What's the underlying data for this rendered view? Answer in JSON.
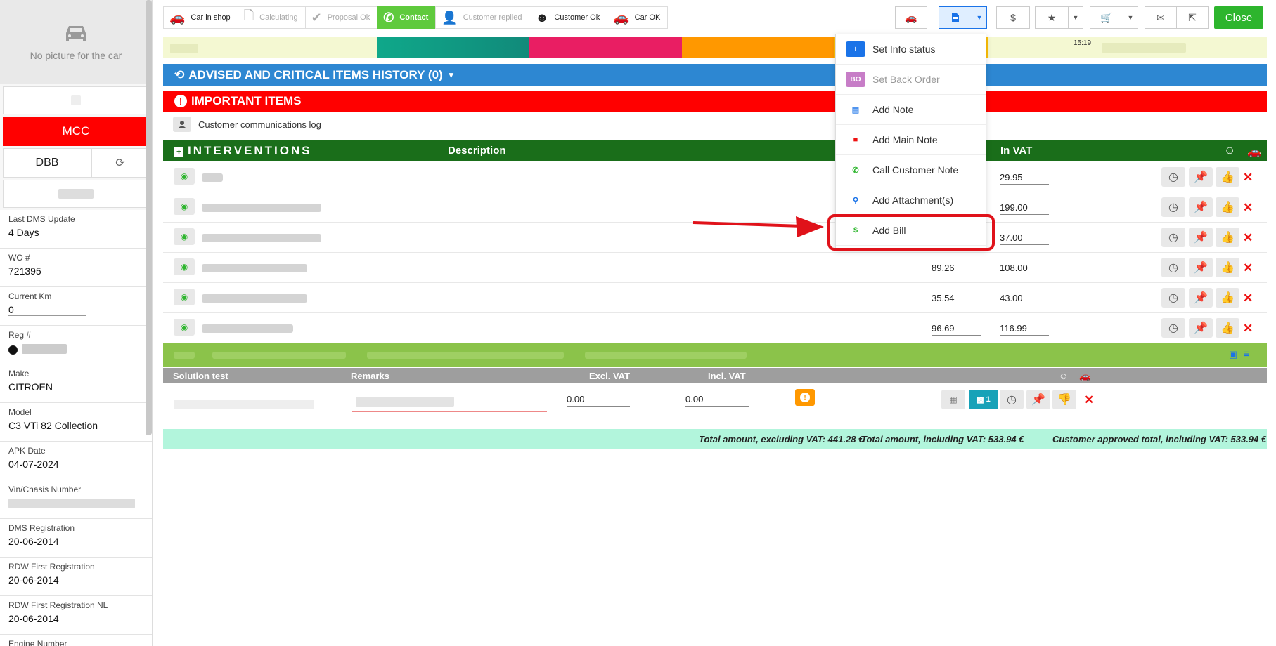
{
  "sidebar": {
    "no_picture": "No picture for the car",
    "mcc": "MCC",
    "dbb": "DBB",
    "fields": [
      {
        "label": "Last DMS Update",
        "value": "4 Days"
      },
      {
        "label": "WO #",
        "value": "721395"
      },
      {
        "label": "Current Km",
        "value": "0"
      },
      {
        "label": "Reg #",
        "value": ""
      },
      {
        "label": "Make",
        "value": "CITROEN"
      },
      {
        "label": "Model",
        "value": "C3 VTi 82 Collection"
      },
      {
        "label": "APK Date",
        "value": "04-07-2024"
      },
      {
        "label": "Vin/Chasis Number",
        "value": ""
      },
      {
        "label": "DMS Registration",
        "value": "20-06-2014"
      },
      {
        "label": "RDW First Registration",
        "value": "20-06-2014"
      },
      {
        "label": "RDW First Registration NL",
        "value": "20-06-2014"
      },
      {
        "label": "Engine Number",
        "value": ""
      }
    ]
  },
  "steps": [
    {
      "label": "Car in shop",
      "state": "done"
    },
    {
      "label": "Calculating",
      "state": "dim"
    },
    {
      "label": "Proposal Ok",
      "state": "dim"
    },
    {
      "label": "Contact",
      "state": "active"
    },
    {
      "label": "Customer replied",
      "state": "dim"
    },
    {
      "label": "Customer Ok",
      "state": "done"
    },
    {
      "label": "Car OK",
      "state": "done"
    }
  ],
  "toolbar": {
    "close": "Close",
    "dollar": "$"
  },
  "colorbar": {
    "time": "15:19"
  },
  "sections": {
    "advised": "ADVISED AND CRITICAL ITEMS HISTORY (0)",
    "important": "IMPORTANT ITEMS",
    "comm_log": "Customer communications log",
    "interventions": "INTERVENTIONS",
    "description": "Description",
    "in_vat": "In VAT"
  },
  "interventions": [
    {
      "excl": "",
      "incl": "29.95"
    },
    {
      "excl": "",
      "incl": "199.00"
    },
    {
      "excl": "",
      "incl": "37.00"
    },
    {
      "excl": "89.26",
      "incl": "108.00"
    },
    {
      "excl": "35.54",
      "incl": "43.00"
    },
    {
      "excl": "96.69",
      "incl": "116.99"
    }
  ],
  "solution": {
    "headers": {
      "solution": "Solution test",
      "remarks": "Remarks",
      "excl": "Excl. VAT",
      "incl": "Incl. VAT"
    },
    "excl_value": "0.00",
    "incl_value": "0.00",
    "image_count": "1"
  },
  "totals": {
    "excl": "Total amount, excluding VAT: 441.28 €",
    "incl": "Total amount, including VAT: 533.94 €",
    "approved": "Customer approved total, including VAT: 533.94 €"
  },
  "menu": {
    "items": [
      {
        "label": "Set Info status",
        "icon": "info-icon",
        "color": "#1a73e8",
        "glyph": "i"
      },
      {
        "label": "Set Back Order",
        "icon": "back-order-icon",
        "color": "#c77dc7",
        "glyph": "BO"
      },
      {
        "label": "Add Note",
        "icon": "note-icon",
        "color": "#1a73e8",
        "glyph": "▤"
      },
      {
        "label": "Add Main Note",
        "icon": "main-note-icon",
        "color": "#e11",
        "glyph": "■"
      },
      {
        "label": "Call Customer Note",
        "icon": "phone-icon",
        "color": "#2db52d",
        "glyph": "✆"
      },
      {
        "label": "Add Attachment(s)",
        "icon": "paperclip-icon",
        "color": "#1a73e8",
        "glyph": "⚲"
      },
      {
        "label": "Add Bill",
        "icon": "bill-icon",
        "color": "#2db52d",
        "glyph": "$"
      }
    ]
  }
}
